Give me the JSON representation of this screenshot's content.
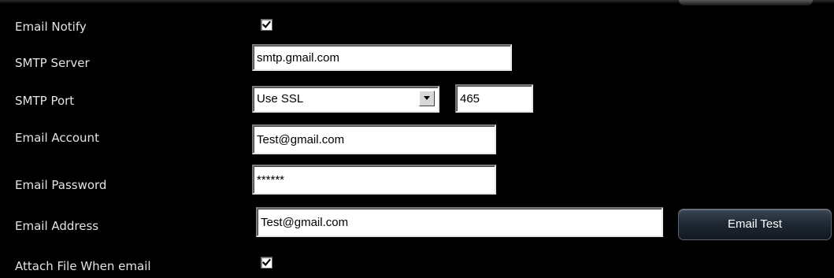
{
  "colors": {
    "background": "#000000",
    "label_text": "#e4e4e4",
    "button_top": "#3b4654",
    "button_bottom": "#111820",
    "button_text": "#ffffff"
  },
  "icons": {
    "checkmark": "check-icon",
    "dropdown": "chevron-down-icon"
  },
  "email_notify": {
    "label": "Email Notify",
    "checked": true
  },
  "smtp_server": {
    "label": "SMTP Server",
    "value": "smtp.gmail.com"
  },
  "smtp_port": {
    "label": "SMTP Port",
    "security_selected": "Use SSL",
    "port_value": "465"
  },
  "email_account": {
    "label": "Email Account",
    "value": "Test@gmail.com"
  },
  "email_password": {
    "label": "Email Password",
    "value": "******"
  },
  "email_address": {
    "label": "Email Address",
    "value": "Test@gmail.com",
    "test_button_label": "Email Test"
  },
  "attach_file": {
    "label": "Attach File When email",
    "checked": true
  }
}
